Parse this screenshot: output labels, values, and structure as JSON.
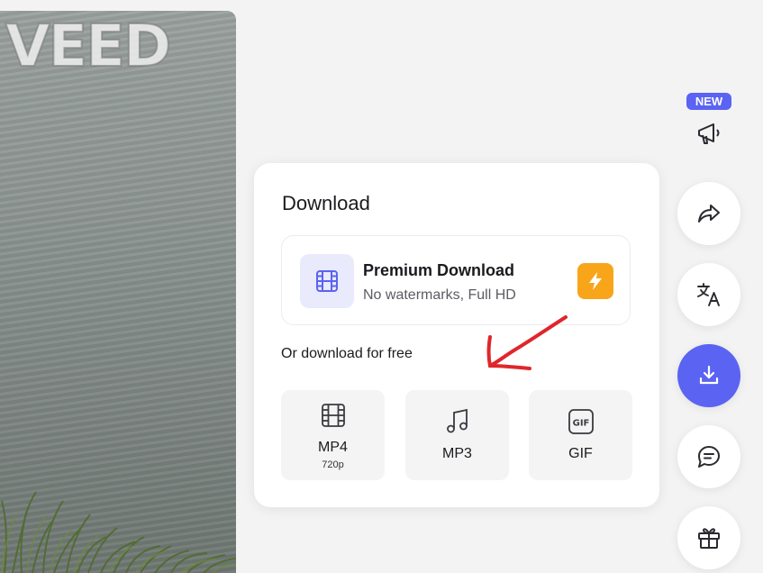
{
  "video": {
    "logo_text": "VEED"
  },
  "download": {
    "title": "Download",
    "premium": {
      "title": "Premium Download",
      "subtitle": "No watermarks, Full HD",
      "icon": "film-icon",
      "badge_icon": "bolt-icon"
    },
    "free_label": "Or download for free",
    "formats": [
      {
        "label": "MP4",
        "sub": "720p",
        "icon": "film-icon"
      },
      {
        "label": "MP3",
        "sub": "",
        "icon": "music-note-icon"
      },
      {
        "label": "GIF",
        "sub": "",
        "icon": "gif-icon"
      }
    ]
  },
  "rail": {
    "new_badge": "NEW",
    "buttons": [
      "megaphone-icon",
      "share-icon",
      "translate-icon",
      "download-icon",
      "comment-icon",
      "gift-icon"
    ]
  },
  "colors": {
    "accent": "#5b63f2",
    "bolt": "#f8a51a",
    "annotation": "#e0262b"
  }
}
